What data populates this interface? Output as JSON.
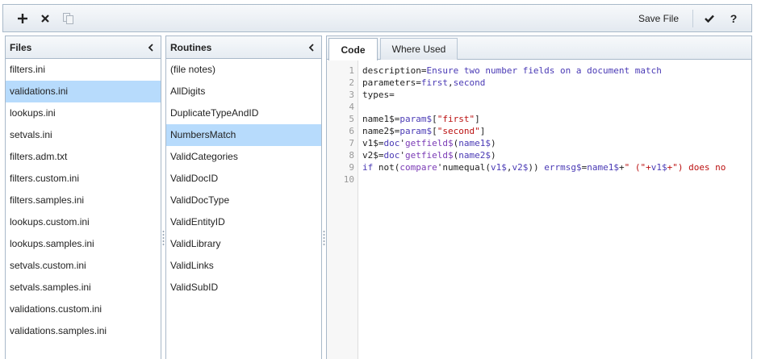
{
  "toolbar": {
    "add_icon": "plus-icon",
    "delete_icon": "close-icon",
    "copy_icon": "copy-icon",
    "save_label": "Save File",
    "check_icon": "checkmark-icon",
    "help_label": "?"
  },
  "files": {
    "title": "Files",
    "items": [
      {
        "label": "filters.ini"
      },
      {
        "label": "validations.ini",
        "selected": true
      },
      {
        "label": "lookups.ini"
      },
      {
        "label": "setvals.ini"
      },
      {
        "label": "filters.adm.txt"
      },
      {
        "label": "filters.custom.ini"
      },
      {
        "label": "filters.samples.ini"
      },
      {
        "label": "lookups.custom.ini"
      },
      {
        "label": "lookups.samples.ini"
      },
      {
        "label": "setvals.custom.ini"
      },
      {
        "label": "setvals.samples.ini"
      },
      {
        "label": "validations.custom.ini"
      },
      {
        "label": "validations.samples.ini"
      }
    ]
  },
  "routines": {
    "title": "Routines",
    "items": [
      {
        "label": "(file notes)"
      },
      {
        "label": "AllDigits"
      },
      {
        "label": "DuplicateTypeAndID"
      },
      {
        "label": "NumbersMatch",
        "selected": true
      },
      {
        "label": "ValidCategories"
      },
      {
        "label": "ValidDocID"
      },
      {
        "label": "ValidDocType"
      },
      {
        "label": "ValidEntityID"
      },
      {
        "label": "ValidLibrary"
      },
      {
        "label": "ValidLinks"
      },
      {
        "label": "ValidSubID"
      }
    ]
  },
  "editor": {
    "tabs": [
      {
        "label": "Code",
        "active": true
      },
      {
        "label": "Where Used",
        "active": false
      }
    ],
    "lines": [
      {
        "num": "1",
        "tokens": [
          [
            "plain",
            "description="
          ],
          [
            "key",
            "Ensure two number fields on a document match"
          ]
        ]
      },
      {
        "num": "2",
        "tokens": [
          [
            "plain",
            "parameters="
          ],
          [
            "key",
            "first"
          ],
          [
            "plain",
            ","
          ],
          [
            "key",
            "second"
          ]
        ]
      },
      {
        "num": "3",
        "tokens": [
          [
            "plain",
            "types="
          ]
        ]
      },
      {
        "num": "4",
        "tokens": []
      },
      {
        "num": "5",
        "tokens": [
          [
            "plain",
            "name1$="
          ],
          [
            "key",
            "param$"
          ],
          [
            "plain",
            "["
          ],
          [
            "str",
            "\"first\""
          ],
          [
            "plain",
            "]"
          ]
        ]
      },
      {
        "num": "6",
        "tokens": [
          [
            "plain",
            "name2$="
          ],
          [
            "key",
            "param$"
          ],
          [
            "plain",
            "["
          ],
          [
            "str",
            "\"second\""
          ],
          [
            "plain",
            "]"
          ]
        ]
      },
      {
        "num": "7",
        "tokens": [
          [
            "plain",
            "v1$="
          ],
          [
            "key",
            "doc"
          ],
          [
            "plain",
            "'"
          ],
          [
            "fn",
            "getfield$"
          ],
          [
            "plain",
            "("
          ],
          [
            "key",
            "name1$"
          ],
          [
            "plain",
            ")"
          ]
        ]
      },
      {
        "num": "8",
        "tokens": [
          [
            "plain",
            "v2$="
          ],
          [
            "key",
            "doc"
          ],
          [
            "plain",
            "'"
          ],
          [
            "fn",
            "getfield$"
          ],
          [
            "plain",
            "("
          ],
          [
            "key",
            "name2$"
          ],
          [
            "plain",
            ")"
          ]
        ]
      },
      {
        "num": "9",
        "tokens": [
          [
            "key",
            "if"
          ],
          [
            "plain",
            " not("
          ],
          [
            "fn",
            "compare"
          ],
          [
            "plain",
            "'numequal("
          ],
          [
            "key",
            "v1$"
          ],
          [
            "plain",
            ","
          ],
          [
            "key",
            "v2$"
          ],
          [
            "plain",
            ")) "
          ],
          [
            "key",
            "errmsg$"
          ],
          [
            "plain",
            "="
          ],
          [
            "key",
            "name1$"
          ],
          [
            "plain",
            "+"
          ],
          [
            "str",
            "\" (\"+"
          ],
          [
            "key",
            "v1$"
          ],
          [
            "str",
            "+\") does no"
          ]
        ]
      },
      {
        "num": "10",
        "tokens": []
      }
    ]
  },
  "colors": {
    "selected_bg": "#b7dbfc",
    "border": "#a9b9c9",
    "keyword": "#4a3ab5",
    "string": "#b11111"
  }
}
